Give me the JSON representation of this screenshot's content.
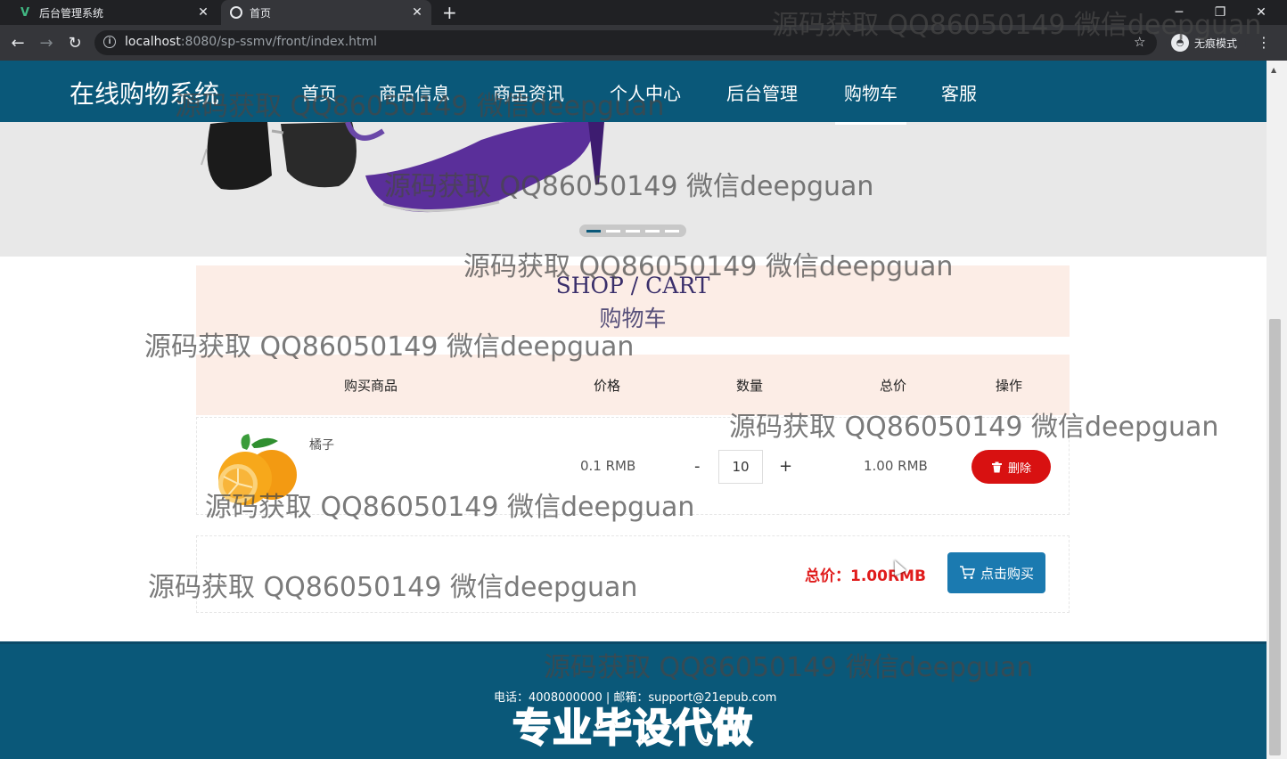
{
  "browser": {
    "tabs": [
      {
        "title": "后台管理系统",
        "icon": "vue-logo-icon",
        "active": false
      },
      {
        "title": "首页",
        "icon": "globe-icon",
        "active": true
      }
    ],
    "url_host": "localhost",
    "url_rest": ":8080/sp-ssmv/front/index.html",
    "incognito_label": "无痕模式"
  },
  "site": {
    "brand": "在线购物系统",
    "nav": [
      "首页",
      "商品信息",
      "商品资讯",
      "个人中心",
      "后台管理",
      "购物车",
      "客服"
    ],
    "active_nav": "购物车"
  },
  "cart": {
    "heading_en": "SHOP / CART",
    "heading_cn": "购物车",
    "columns": [
      "购买商品",
      "价格",
      "数量",
      "总价",
      "操作"
    ],
    "items": [
      {
        "name": "橘子",
        "price": "0.1 RMB",
        "quantity": "10",
        "subtotal": "1.00 RMB",
        "delete_label": "删除"
      }
    ],
    "minus": "-",
    "plus": "+",
    "total": "总价：1.00RMB",
    "buy_label": "点击购买"
  },
  "footer": {
    "contact": "电话：4008000000 | 邮箱：support@21epub.com",
    "promo": "专业毕设代做"
  },
  "watermark": "源码获取 QQ86050149 微信deepguan",
  "colors": {
    "nav_bg": "#0a5879",
    "header_bg": "#fcede6",
    "delete_btn": "#d81111",
    "buy_btn": "#1b7ab0",
    "total_text": "#e01c1c"
  }
}
